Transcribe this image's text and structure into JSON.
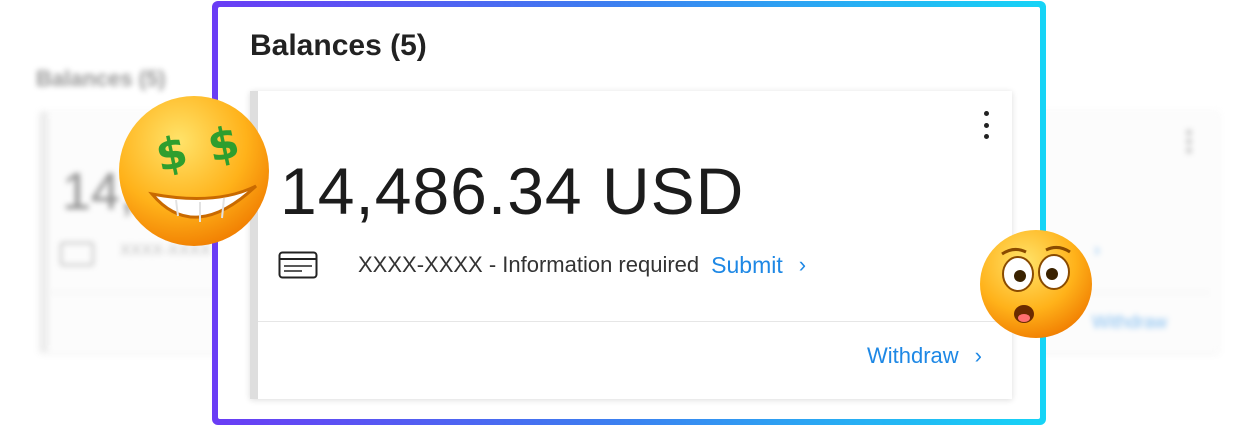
{
  "panel": {
    "title": "Balances (5)"
  },
  "card": {
    "amount": "14,486.34 USD",
    "account_text": "XXXX-XXXX - Information required",
    "submit_label": "Submit",
    "withdraw_label": "Withdraw",
    "chevron": "›"
  },
  "background": {
    "title": "Balances (5)",
    "amount_fragment": "14,",
    "account_fragment": "XXXX-XXXX",
    "withdraw_label": "Withdraw"
  },
  "colors": {
    "link": "#1e88e5",
    "frame_gradient_start": "#6a3cf5",
    "frame_gradient_end": "#16d4f6"
  },
  "icons": [
    "more-vert-icon",
    "credit-card-icon",
    "chevron-right-icon",
    "money-face-emoji",
    "astonished-face-emoji"
  ]
}
